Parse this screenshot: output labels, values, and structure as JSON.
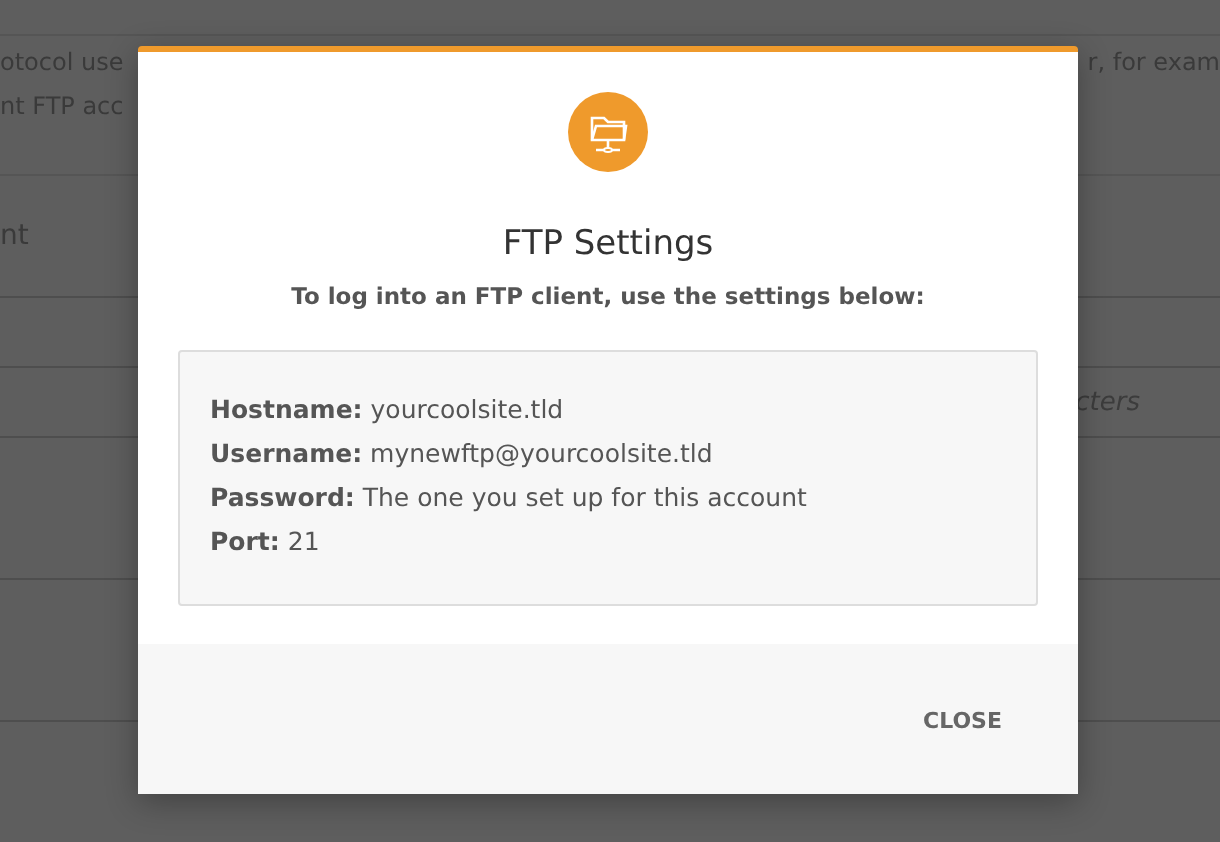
{
  "background": {
    "intro_lines": [
      {
        "left": "otocol use",
        "right": "r, for exam"
      },
      {
        "left": "nt FTP acc"
      }
    ],
    "heading": "nt",
    "field_hint": "cters"
  },
  "dialog": {
    "title": "FTP Settings",
    "subtitle": "To log into an FTP client, use the settings below:",
    "settings": [
      {
        "label": "Hostname:",
        "value": "yourcoolsite.tld"
      },
      {
        "label": "Username:",
        "value": "mynewftp@yourcoolsite.tld"
      },
      {
        "label": "Password:",
        "value": "The one you set up for this account"
      },
      {
        "label": "Port:",
        "value": "21"
      }
    ],
    "close_button": "CLOSE"
  }
}
